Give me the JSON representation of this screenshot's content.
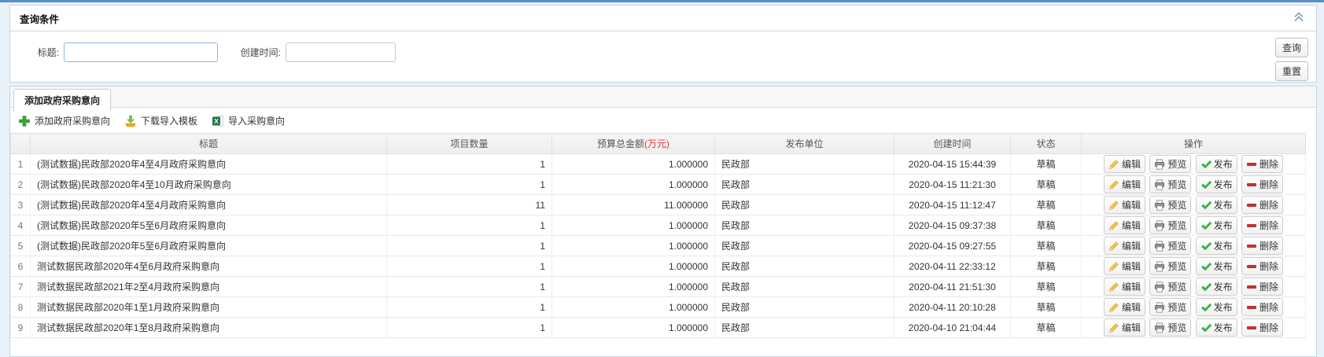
{
  "query_panel": {
    "title": "查询条件",
    "fields": {
      "title_label": "标题:",
      "title_value": "",
      "created_label": "创建时间:",
      "created_value": ""
    },
    "buttons": {
      "search": "查询",
      "reset": "重置"
    }
  },
  "tabs": [
    {
      "label": "添加政府采购意向",
      "active": true
    }
  ],
  "toolbar": {
    "add_label": "添加政府采购意向",
    "download_template_label": "下载导入模板",
    "import_label": "导入采购意向"
  },
  "table": {
    "columns": {
      "index": "",
      "title": "标题",
      "count": "项目数量",
      "budget": "预算总金额",
      "budget_unit_suffix": "(万元)",
      "org": "发布单位",
      "created": "创建时间",
      "status": "状态",
      "actions": "操作"
    },
    "row_actions": {
      "edit": "编辑",
      "preview": "预览",
      "publish": "发布",
      "delete": "删除"
    },
    "rows": [
      {
        "index": "1",
        "title": "(测试数据)民政部2020年4至4月政府采购意向",
        "count": "1",
        "budget": "1.000000",
        "org": "民政部",
        "created": "2020-04-15 15:44:39",
        "status": "草稿"
      },
      {
        "index": "2",
        "title": "(测试数据)民政部2020年4至10月政府采购意向",
        "count": "1",
        "budget": "1.000000",
        "org": "民政部",
        "created": "2020-04-15 11:21:30",
        "status": "草稿"
      },
      {
        "index": "3",
        "title": "(测试数据)民政部2020年4至4月政府采购意向",
        "count": "11",
        "budget": "11.000000",
        "org": "民政部",
        "created": "2020-04-15 11:12:47",
        "status": "草稿"
      },
      {
        "index": "4",
        "title": "(测试数据)民政部2020年5至6月政府采购意向",
        "count": "1",
        "budget": "1.000000",
        "org": "民政部",
        "created": "2020-04-15 09:37:38",
        "status": "草稿"
      },
      {
        "index": "5",
        "title": "(测试数据)民政部2020年5至6月政府采购意向",
        "count": "1",
        "budget": "1.000000",
        "org": "民政部",
        "created": "2020-04-15 09:27:55",
        "status": "草稿"
      },
      {
        "index": "6",
        "title": "测试数据民政部2020年4至6月政府采购意向",
        "count": "1",
        "budget": "1.000000",
        "org": "民政部",
        "created": "2020-04-11 22:33:12",
        "status": "草稿"
      },
      {
        "index": "7",
        "title": "测试数据民政部2021年2至4月政府采购意向",
        "count": "1",
        "budget": "1.000000",
        "org": "民政部",
        "created": "2020-04-11 21:51:30",
        "status": "草稿"
      },
      {
        "index": "8",
        "title": "测试数据民政部2020年1至1月政府采购意向",
        "count": "1",
        "budget": "1.000000",
        "org": "民政部",
        "created": "2020-04-11 20:10:28",
        "status": "草稿"
      },
      {
        "index": "9",
        "title": "测试数据民政部2020年1至8月政府采购意向",
        "count": "1",
        "budget": "1.000000",
        "org": "民政部",
        "created": "2020-04-10 21:04:44",
        "status": "草稿"
      }
    ]
  },
  "colors": {
    "top_accent": "#5a8fc8",
    "panel_border": "#c6d5e4",
    "focused_input_border": "#8db6e3",
    "budget_unit_red": "#e03131",
    "add_icon_green": "#3aa33a",
    "publish_check_green": "#3cb54a",
    "delete_minus_red": "#cc3333",
    "pencil_yellow": "#f6c344",
    "download_tray_orange": "#f5a623",
    "excel_green": "#217346"
  }
}
